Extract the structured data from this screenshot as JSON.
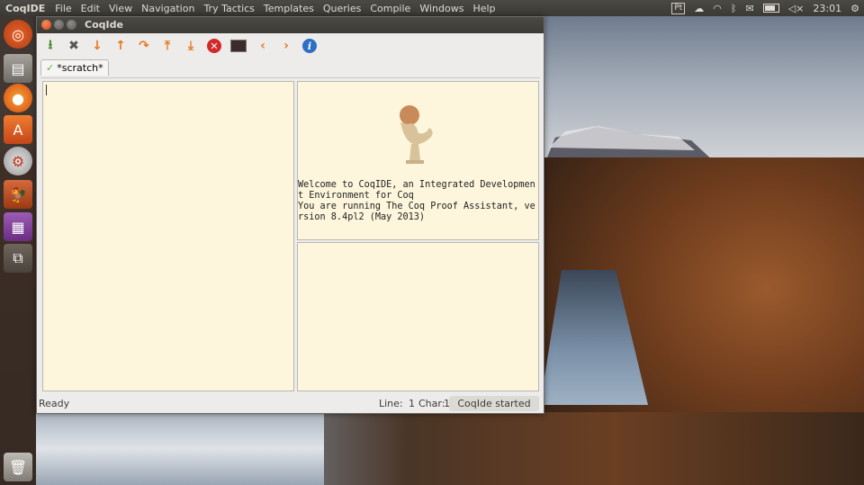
{
  "top_panel": {
    "app_name": "CoqIDE",
    "menu": [
      "File",
      "Edit",
      "View",
      "Navigation",
      "Try Tactics",
      "Templates",
      "Queries",
      "Compile",
      "Windows",
      "Help"
    ],
    "indicator_pt": "Pt",
    "clock": "23:01"
  },
  "launcher": {
    "items": [
      {
        "name": "ubuntu-dash",
        "color": "#d9531e"
      },
      {
        "name": "files",
        "color": "#7d7a72"
      },
      {
        "name": "firefox",
        "color": "#e66a1e"
      },
      {
        "name": "software-center",
        "color": "#e2641b"
      },
      {
        "name": "system-settings",
        "color": "#c9362b"
      },
      {
        "name": "coqide",
        "color": "#b5471f"
      },
      {
        "name": "workspaces",
        "color": "#8b4fa0"
      },
      {
        "name": "workspace-switcher",
        "color": "#6a6157"
      },
      {
        "name": "trash",
        "color": "#8e8a82"
      }
    ]
  },
  "window": {
    "title": "CoqIde",
    "tab_label": "*scratch*",
    "goal_text": "Welcome to CoqIDE, an Integrated Development Environment for Coq\nYou are running The Coq Proof Assistant, version 8.4pl2 (May 2013)",
    "status": {
      "ready": "Ready",
      "line_label": "Line:",
      "line_value": "1",
      "char_label": "Char:",
      "char_value": "1",
      "started": "CoqIde started"
    }
  },
  "toolbar": {
    "icons": [
      "save-icon",
      "close-icon",
      "forward-icon",
      "backward-icon",
      "go-to-cursor-icon",
      "restart-icon",
      "go-to-end-icon",
      "interrupt-icon",
      "query-pane-icon",
      "previous-icon",
      "next-icon",
      "about-icon"
    ]
  }
}
